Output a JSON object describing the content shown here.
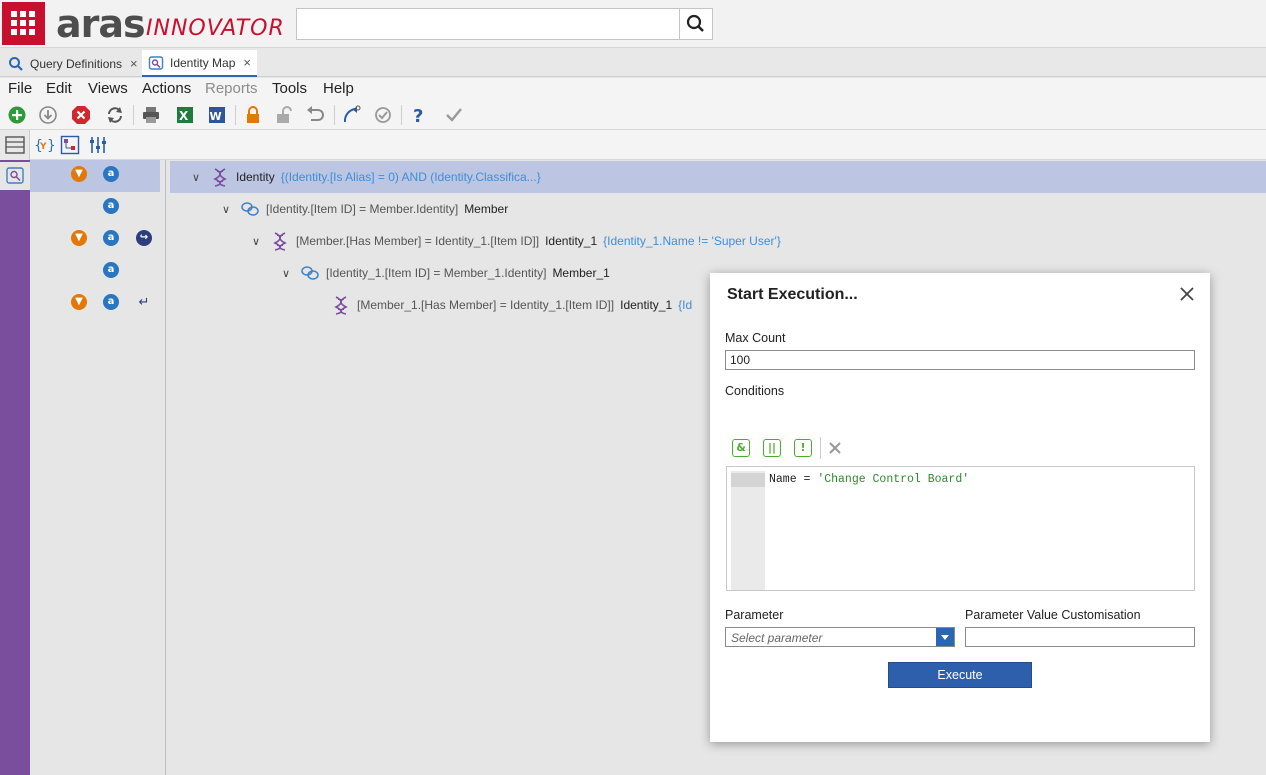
{
  "header": {
    "logo_primary": "aras",
    "logo_secondary": "INNOVATOR",
    "search_placeholder": ""
  },
  "tabs": [
    {
      "label": "Query Definitions",
      "close": "×"
    },
    {
      "label": "Identity Map",
      "close": "×"
    }
  ],
  "menu": [
    "File",
    "Edit",
    "Views",
    "Actions",
    "Reports",
    "Tools",
    "Help"
  ],
  "menu_disabled": [
    "Reports"
  ],
  "tree": {
    "rows": [
      {
        "ref": "",
        "item": "Identity",
        "condition": "{(Identity.[Is Alias] = 0) AND (Identity.Classifica...}"
      },
      {
        "ref": "[Identity.[Item ID] = Member.Identity]",
        "item": "Member",
        "condition": ""
      },
      {
        "ref": "[Member.[Has Member] = Identity_1.[Item ID]]",
        "item": "Identity_1",
        "condition": "{Identity_1.Name != 'Super User'}"
      },
      {
        "ref": "[Identity_1.[Item ID] = Member_1.Identity]",
        "item": "Member_1",
        "condition": ""
      },
      {
        "ref": "[Member_1.[Has Member] = Identity_1.[Item ID]]",
        "item": "Identity_1",
        "condition": "{Id"
      }
    ]
  },
  "dialog": {
    "title": "Start Execution...",
    "max_count_label": "Max Count",
    "max_count_value": "100",
    "conditions_label": "Conditions",
    "condition_buttons": [
      "&",
      "||",
      "!"
    ],
    "code_plain": "Name = ",
    "code_string": "'Change Control Board'",
    "parameter_label": "Parameter",
    "parameter_placeholder": "Select parameter",
    "param_value_label": "Parameter Value Customisation",
    "param_value_value": "",
    "execute_label": "Execute"
  },
  "colors": {
    "brand_red": "#c8102e",
    "side_purple": "#7b4d9d",
    "selection_blue": "#bcc6e3",
    "condition_blue": "#3e8ed8",
    "accent_blue": "#2e5fad"
  }
}
